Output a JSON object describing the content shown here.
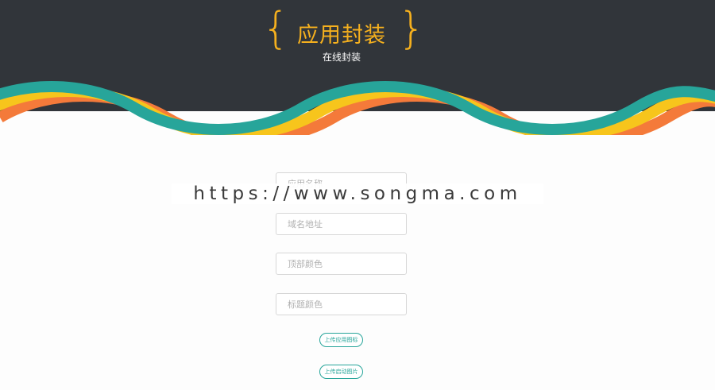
{
  "header": {
    "title": "应用封装",
    "subtitle": "在线封装",
    "brace_left": "{",
    "brace_right": "}"
  },
  "form": {
    "fields": [
      {
        "placeholder": "应用名称"
      },
      {
        "placeholder": "域名地址"
      },
      {
        "placeholder": "顶部颜色"
      },
      {
        "placeholder": "标题颜色"
      }
    ],
    "buttons": [
      {
        "label": "上传应用图标"
      },
      {
        "label": "上传启动图片"
      }
    ]
  },
  "watermark": "https://www.songma.com",
  "colors": {
    "header_bg": "#31353a",
    "accent_yellow": "#f5b01e",
    "ribbon_orange": "#f47a3a",
    "ribbon_yellow": "#f7c51c",
    "ribbon_teal": "#27a59a"
  }
}
